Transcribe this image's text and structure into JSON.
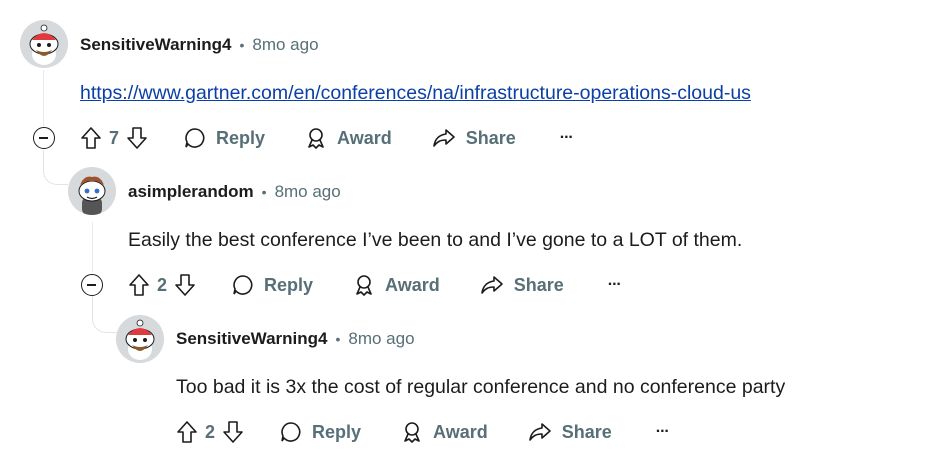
{
  "comments": [
    {
      "author": "SensitiveWarning4",
      "separator": "•",
      "time": "8mo ago",
      "body": "https://www.gartner.com/en/conferences/na/infrastructure-operations-cloud-us",
      "votes": "7",
      "reply": "Reply",
      "award": "Award",
      "share": "Share",
      "more": "···"
    },
    {
      "author": "asimplerandom",
      "separator": "•",
      "time": "8mo ago",
      "body": "Easily the best conference I’ve been to and I’ve gone to a LOT of them.",
      "votes": "2",
      "reply": "Reply",
      "award": "Award",
      "share": "Share",
      "more": "···"
    },
    {
      "author": "SensitiveWarning4",
      "separator": "•",
      "time": "8mo ago",
      "body": "Too bad it is 3x the cost of regular conference and no conference party",
      "votes": "2",
      "reply": "Reply",
      "award": "Award",
      "share": "Share",
      "more": "···"
    }
  ],
  "icons": {
    "upvote": "upvote-icon",
    "downvote": "downvote-icon",
    "reply": "reply-bubble-icon",
    "award": "award-icon",
    "share": "share-icon",
    "more": "more-icon",
    "collapse": "collapse-icon"
  },
  "colors": {
    "text": "#1c1c1c",
    "meta": "#576f76",
    "link": "#0b3fa8",
    "thread": "#e5ebee"
  }
}
